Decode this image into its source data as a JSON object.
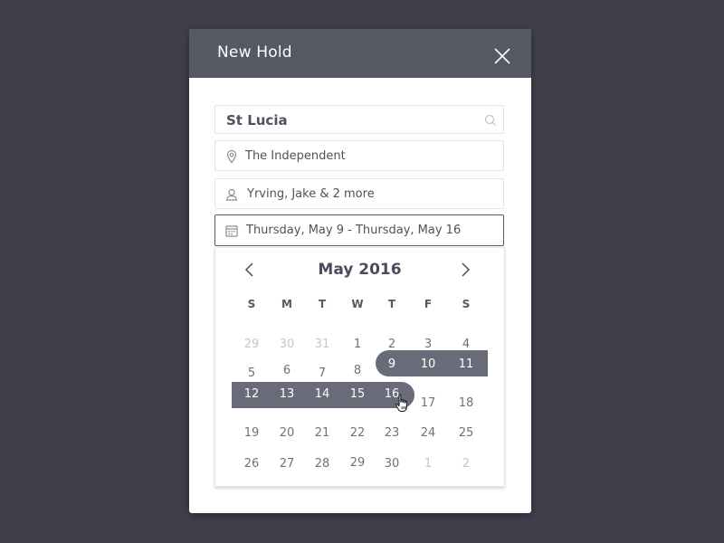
{
  "modal": {
    "title": "New Hold"
  },
  "fields": {
    "search": {
      "value": "St Lucia"
    },
    "venue": {
      "value": "The Independent"
    },
    "people": {
      "value": "Yrving, Jake & 2 more"
    },
    "dates": {
      "value": "Thursday, May 9 - Thursday, May 16"
    }
  },
  "calendar": {
    "month_label": "May 2016",
    "weekdays": [
      "S",
      "M",
      "T",
      "W",
      "T",
      "F",
      "S"
    ],
    "weeks": [
      [
        "29",
        "30",
        "31",
        "1",
        "2",
        "3",
        "4"
      ],
      [
        "5",
        "6",
        "7",
        "8",
        "9",
        "10",
        "11"
      ],
      [
        "12",
        "13",
        "14",
        "15",
        "16",
        "17",
        "18"
      ],
      [
        "19",
        "20",
        "21",
        "22",
        "23",
        "24",
        "25"
      ],
      [
        "26",
        "27",
        "28",
        "29",
        "30",
        "1",
        "2"
      ]
    ],
    "selected_range": {
      "start": "9",
      "end": "16"
    }
  },
  "colors": {
    "background": "#3e3f4b",
    "header": "#565864",
    "range": "#6a6b79",
    "accent_border": "#57586a"
  },
  "icons": {
    "close": "close-icon",
    "search": "search-icon",
    "location": "map-pin-icon",
    "person": "user-icon",
    "calendar": "calendar-icon",
    "prev": "chevron-left-icon",
    "next": "chevron-right-icon",
    "cursor": "hand-pointer-icon"
  }
}
